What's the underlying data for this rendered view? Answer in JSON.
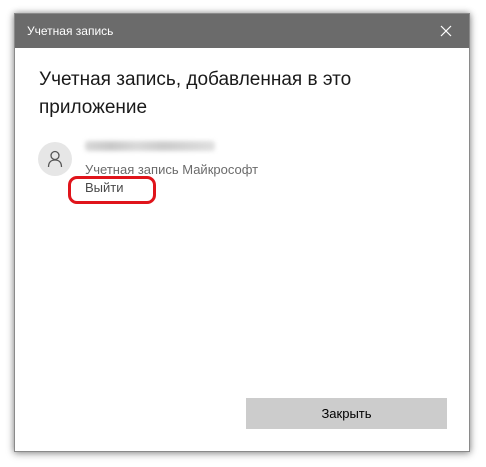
{
  "window": {
    "title": "Учетная запись"
  },
  "main": {
    "heading": "Учетная запись, добавленная в это приложение",
    "account": {
      "type_label": "Учетная запись Майкрософт",
      "signout_label": "Выйти"
    }
  },
  "footer": {
    "close_label": "Закрыть"
  },
  "colors": {
    "titlebar": "#6b6b6b",
    "highlight": "#e0141b",
    "button": "#cccccc"
  },
  "icons": {
    "close": "close-icon",
    "avatar": "person-icon"
  }
}
